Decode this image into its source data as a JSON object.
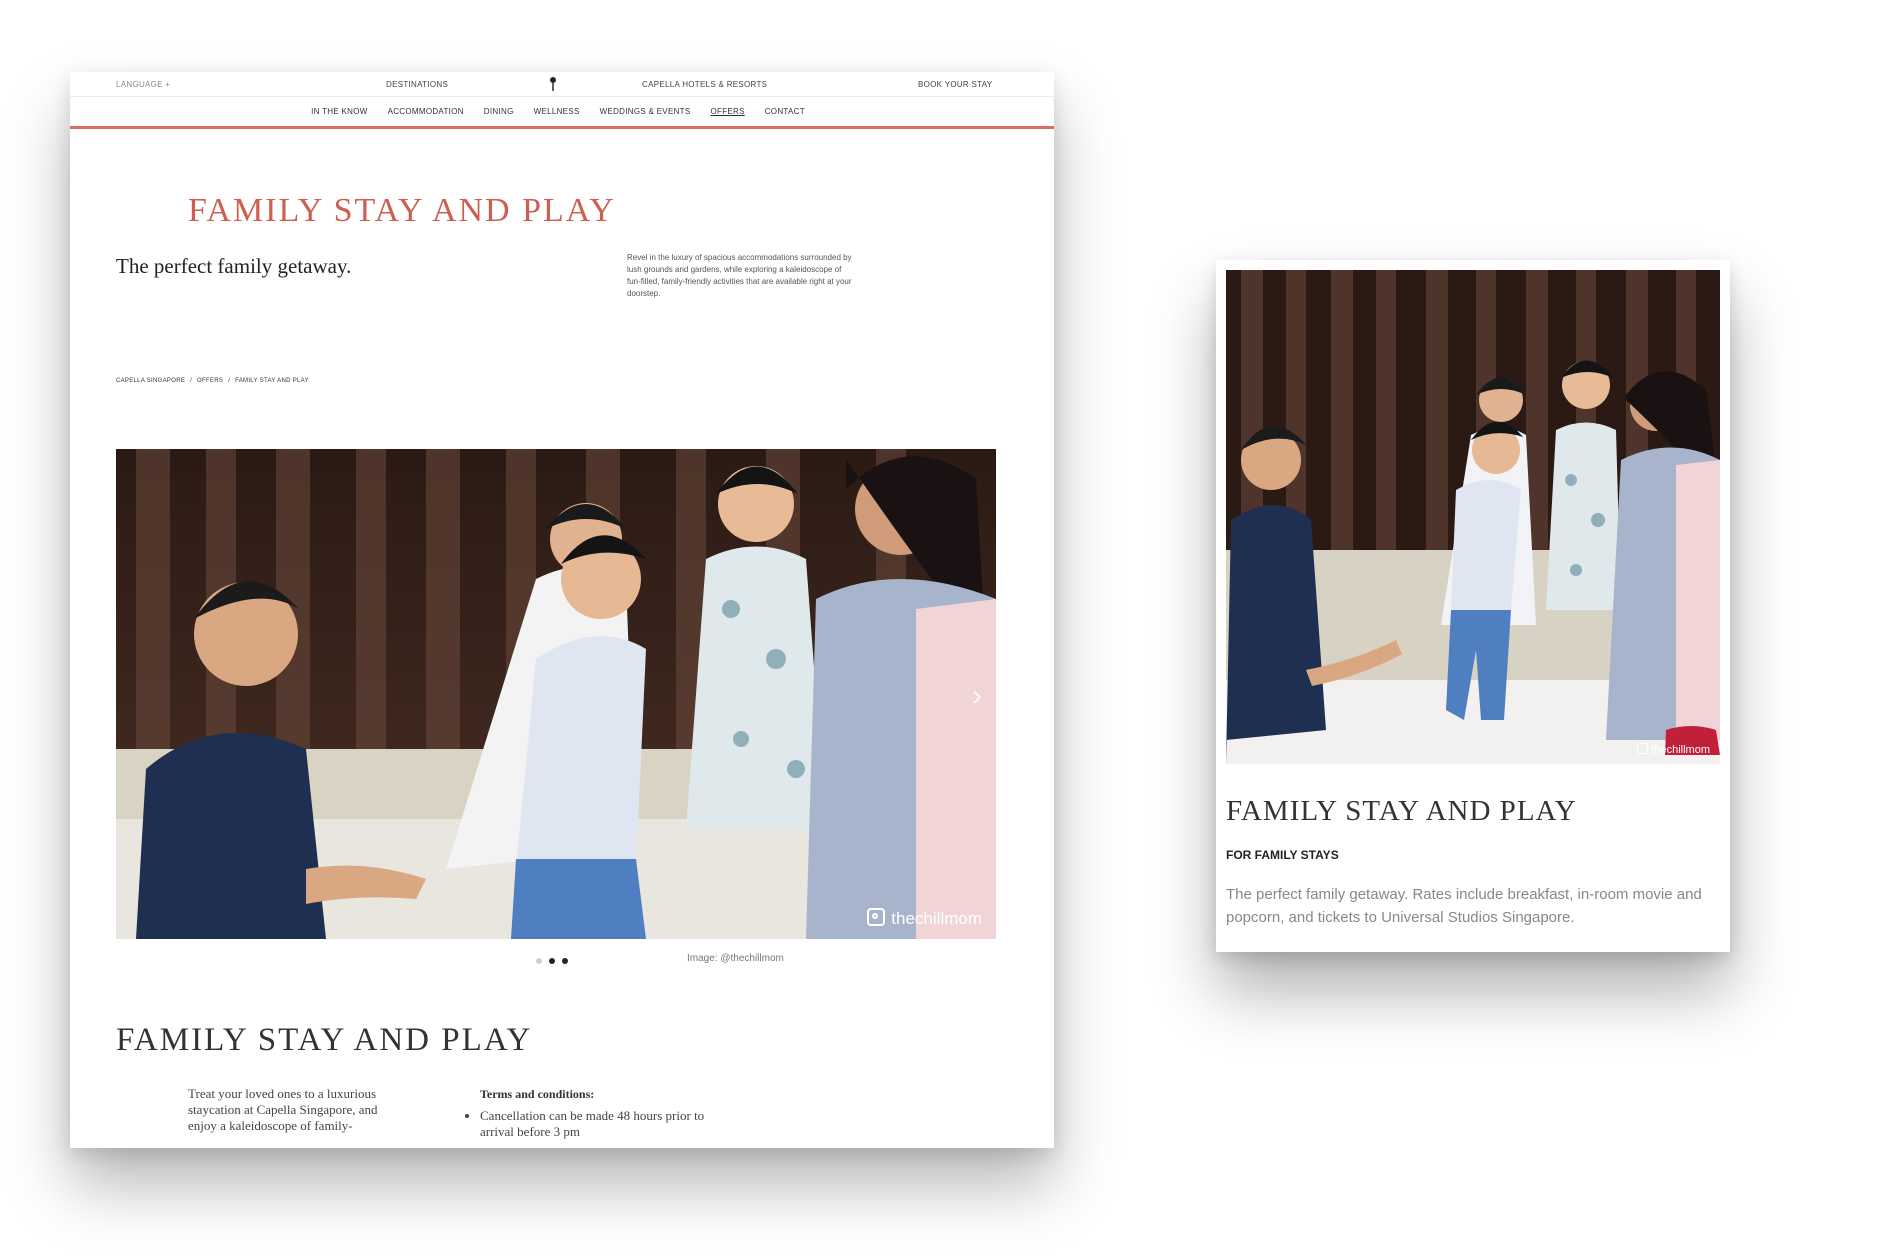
{
  "site": {
    "top_bar": {
      "language": "LANGUAGE +",
      "destinations": "DESTINATIONS",
      "brand": "CAPELLA HOTELS & RESORTS",
      "book": "BOOK YOUR STAY"
    },
    "nav": [
      {
        "label": "IN THE KNOW",
        "active": false
      },
      {
        "label": "ACCOMMODATION",
        "active": false
      },
      {
        "label": "DINING",
        "active": false
      },
      {
        "label": "WELLNESS",
        "active": false
      },
      {
        "label": "WEDDINGS & EVENTS",
        "active": false
      },
      {
        "label": "OFFERS",
        "active": true
      },
      {
        "label": "CONTACT",
        "active": false
      }
    ],
    "accent_color": "#cc5f52"
  },
  "offer_page": {
    "title": "FAMILY STAY AND PLAY",
    "tagline": "The perfect family getaway.",
    "intro": "Revel in the luxury of spacious accommodations surrounded by lush grounds and gardens, while exploring a kaleidoscope of fun-filled, family-friendly activities that are available right at your doorstep.",
    "breadcrumb": [
      "CAPELLA SINGAPORE",
      "/",
      "OFFERS",
      "/",
      "FAMILY STAY AND PLAY"
    ],
    "hero_credit": "thechillmom",
    "image_caption": "Image: @thechillmom",
    "carousel": {
      "count": 3,
      "active_index": 1
    },
    "section_title": "FAMILY STAY AND PLAY",
    "body": "Treat your loved ones to a luxurious staycation at Capella Singapore, and enjoy a kaleidoscope of family-",
    "terms_heading": "Terms and conditions:",
    "terms": [
      "Cancellation can be made 48 hours prior to arrival before 3 pm"
    ]
  },
  "offer_card": {
    "credit": "thechillmom",
    "title": "FAMILY STAY AND PLAY",
    "subtitle": "FOR FAMILY STAYS",
    "description": "The perfect family getaway. Rates include breakfast, in-room movie and popcorn, and tickets to Universal Studios Singapore."
  }
}
